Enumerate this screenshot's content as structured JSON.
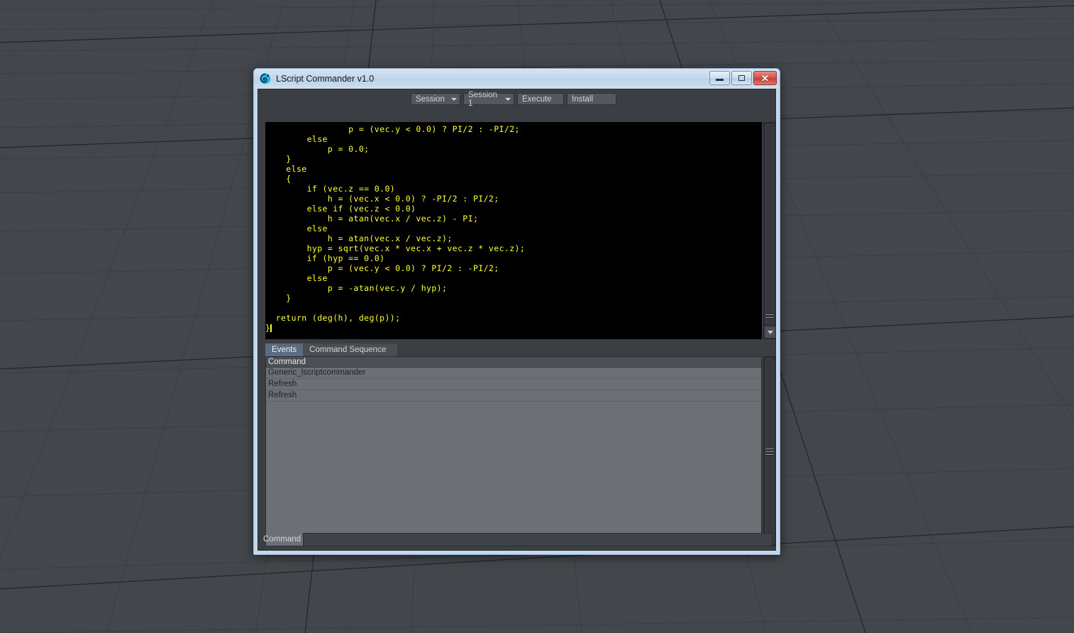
{
  "window": {
    "title": "LScript Commander v1.0",
    "app_icon": "lightwave-swirl-icon",
    "controls": {
      "minimize": "minimize-button",
      "maximize": "maximize-button",
      "close_glyph": "✕"
    }
  },
  "toolbar": {
    "session_type_dropdown": "Session",
    "session_select_dropdown": "Session 1",
    "execute_label": "Execute",
    "install_label": "Install"
  },
  "editor": {
    "code": "                p = (vec.y < 0.0) ? PI/2 : -PI/2;\n        else\n            p = 0.0;\n    }\n    else\n    {\n        if (vec.z == 0.0)\n            h = (vec.x < 0.0) ? -PI/2 : PI/2;\n        else if (vec.z < 0.0)\n            h = atan(vec.x / vec.z) - PI;\n        else\n            h = atan(vec.x / vec.z);\n        hyp = sqrt(vec.x * vec.x + vec.z * vec.z);\n        if (hyp == 0.0)\n            p = (vec.y < 0.0) ? PI/2 : -PI/2;\n        else\n            p = -atan(vec.y / hyp);\n    }\n\n  return (deg(h), deg(p));\n}"
  },
  "tabs": [
    {
      "label": "Events",
      "active": true
    },
    {
      "label": "Command Sequence",
      "active": false
    }
  ],
  "command_list": {
    "header": "Command",
    "rows": [
      "Generic_lscriptcommander",
      "Refresh",
      "Refresh"
    ]
  },
  "command_bar": {
    "label": "Command",
    "value": "",
    "placeholder": ""
  },
  "colors": {
    "window_frame": "#c3d8ec",
    "client_bg": "#3b3f43",
    "editor_bg": "#000000",
    "editor_text": "#ffff33",
    "list_bg": "#6c7074",
    "active_tab": "#5b6b80",
    "viewport_bg": "#43474b",
    "close_button": "#c4423a"
  }
}
